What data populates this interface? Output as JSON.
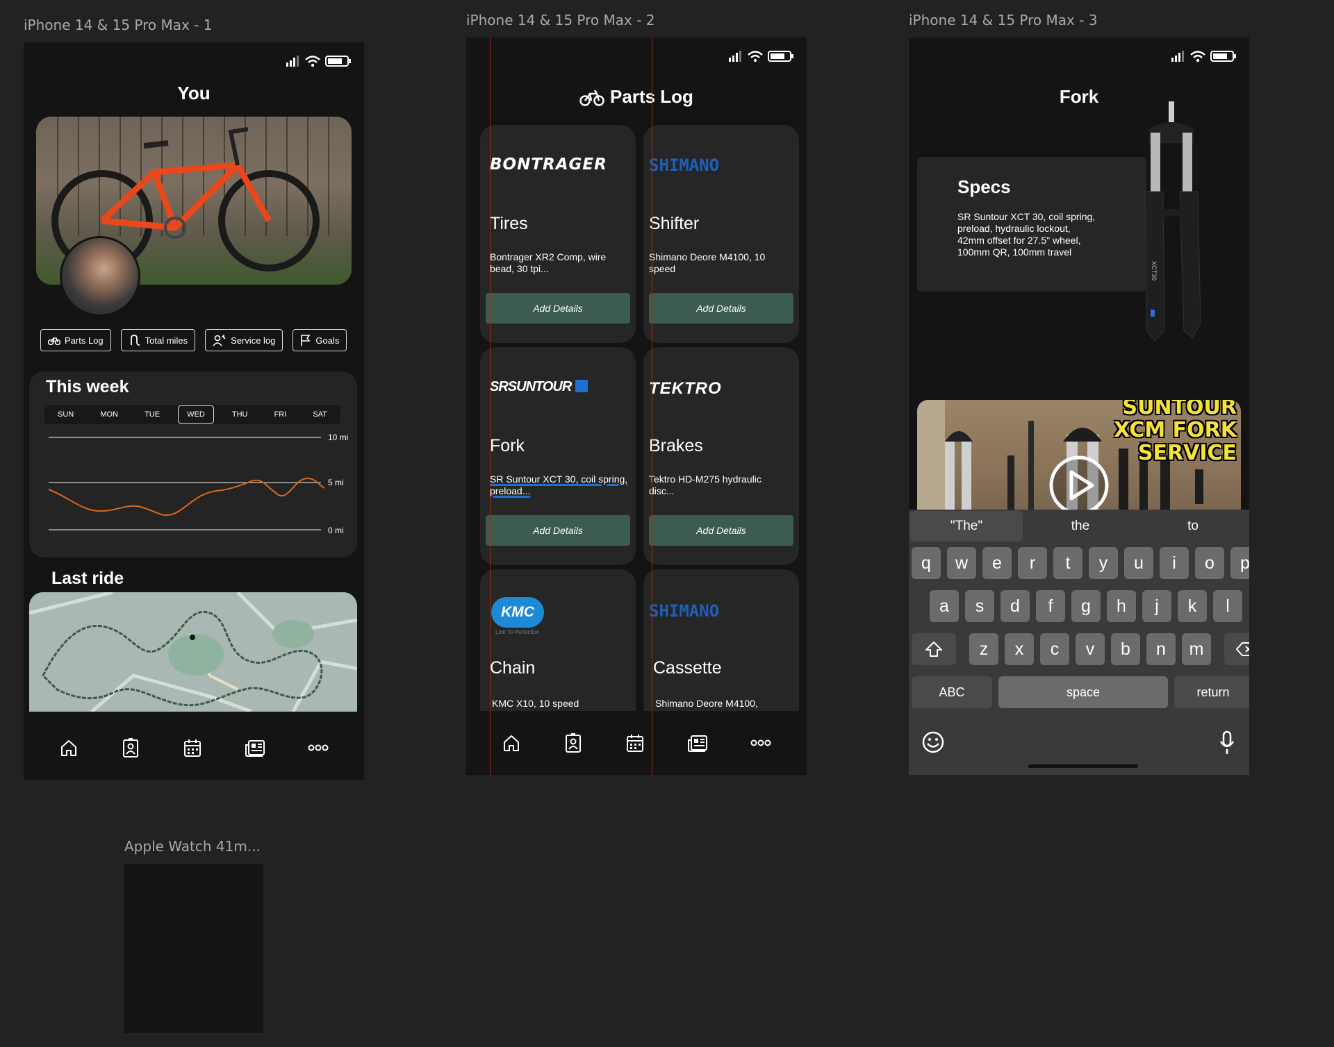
{
  "canvas": {
    "frames": [
      "iPhone 14 & 15 Pro Max - 1",
      "iPhone 14 & 15 Pro Max - 2",
      "iPhone 14 & 15 Pro Max - 3",
      "Apple Watch 41m..."
    ]
  },
  "screen1": {
    "title": "You",
    "chips": [
      {
        "icon": "bike-icon",
        "label": "Parts Log"
      },
      {
        "icon": "route-icon",
        "label": "Total miles"
      },
      {
        "icon": "mechanic-icon",
        "label": "Service log"
      },
      {
        "icon": "flag-icon",
        "label": "Goals"
      }
    ],
    "week": {
      "title": "This week",
      "days": [
        "SUN",
        "MON",
        "TUE",
        "WED",
        "THU",
        "FRI",
        "SAT"
      ],
      "selected_day": "WED",
      "y_labels": [
        "10 mi",
        "5 mi",
        "0 mi"
      ],
      "line_color": "#d9691c"
    },
    "last_ride": "Last ride"
  },
  "screen2": {
    "title": "Parts Log",
    "parts": [
      {
        "brand": "BONTRAGER",
        "brand_color": "#ffffff",
        "name": "Tires",
        "desc": "Bontrager XR2 Comp, wire bead, 30 tpi...",
        "button": "Add Details"
      },
      {
        "brand": "SHIMANO",
        "brand_color": "#1f5fb8",
        "name": "Shifter",
        "desc": "Shimano Deore M4100, 10 speed",
        "button": "Add Details"
      },
      {
        "brand": "SRSUNTOUR",
        "brand_color": "#ffffff",
        "name": "Fork",
        "desc": "SR Suntour XCT 30, coil spring, preload...",
        "button": "Add Details"
      },
      {
        "brand": "TEKTRO",
        "brand_color": "#ffffff",
        "name": "Brakes",
        "desc": "Tektro HD-M275 hydraulic disc...",
        "button": "Add Details"
      },
      {
        "brand": "KMC",
        "brand_color": "#1d8ad6",
        "brand_sub": "Link To Perfection",
        "name": "Chain",
        "desc": "KMC X10, 10 speed"
      },
      {
        "brand": "SHIMANO",
        "brand_color": "#1f5fb8",
        "name": "Cassette",
        "desc": "Shimano Deore M4100,"
      }
    ]
  },
  "screen3": {
    "title": "Fork",
    "specs_title": "Specs",
    "specs_text": "SR Suntour XCT 30, coil spring, preload, hydraulic lockout, 42mm offset for 27.5\" wheel, 100mm QR, 100mm travel",
    "fork_label": "XCT30",
    "video_caption": [
      "SUNTOUR",
      "XCM FORK",
      "SERVICE"
    ],
    "keyboard": {
      "suggestions": [
        "\"The\"",
        "the",
        "to"
      ],
      "row1": [
        "q",
        "w",
        "e",
        "r",
        "t",
        "y",
        "u",
        "i",
        "o",
        "p"
      ],
      "row2": [
        "a",
        "s",
        "d",
        "f",
        "g",
        "h",
        "j",
        "k",
        "l"
      ],
      "row3": [
        "z",
        "x",
        "c",
        "v",
        "b",
        "n",
        "m"
      ],
      "abc": "ABC",
      "space": "space",
      "return": "return"
    }
  },
  "tabbar": [
    "home-icon",
    "profile-icon",
    "calendar-icon",
    "news-icon",
    "more-icon"
  ]
}
